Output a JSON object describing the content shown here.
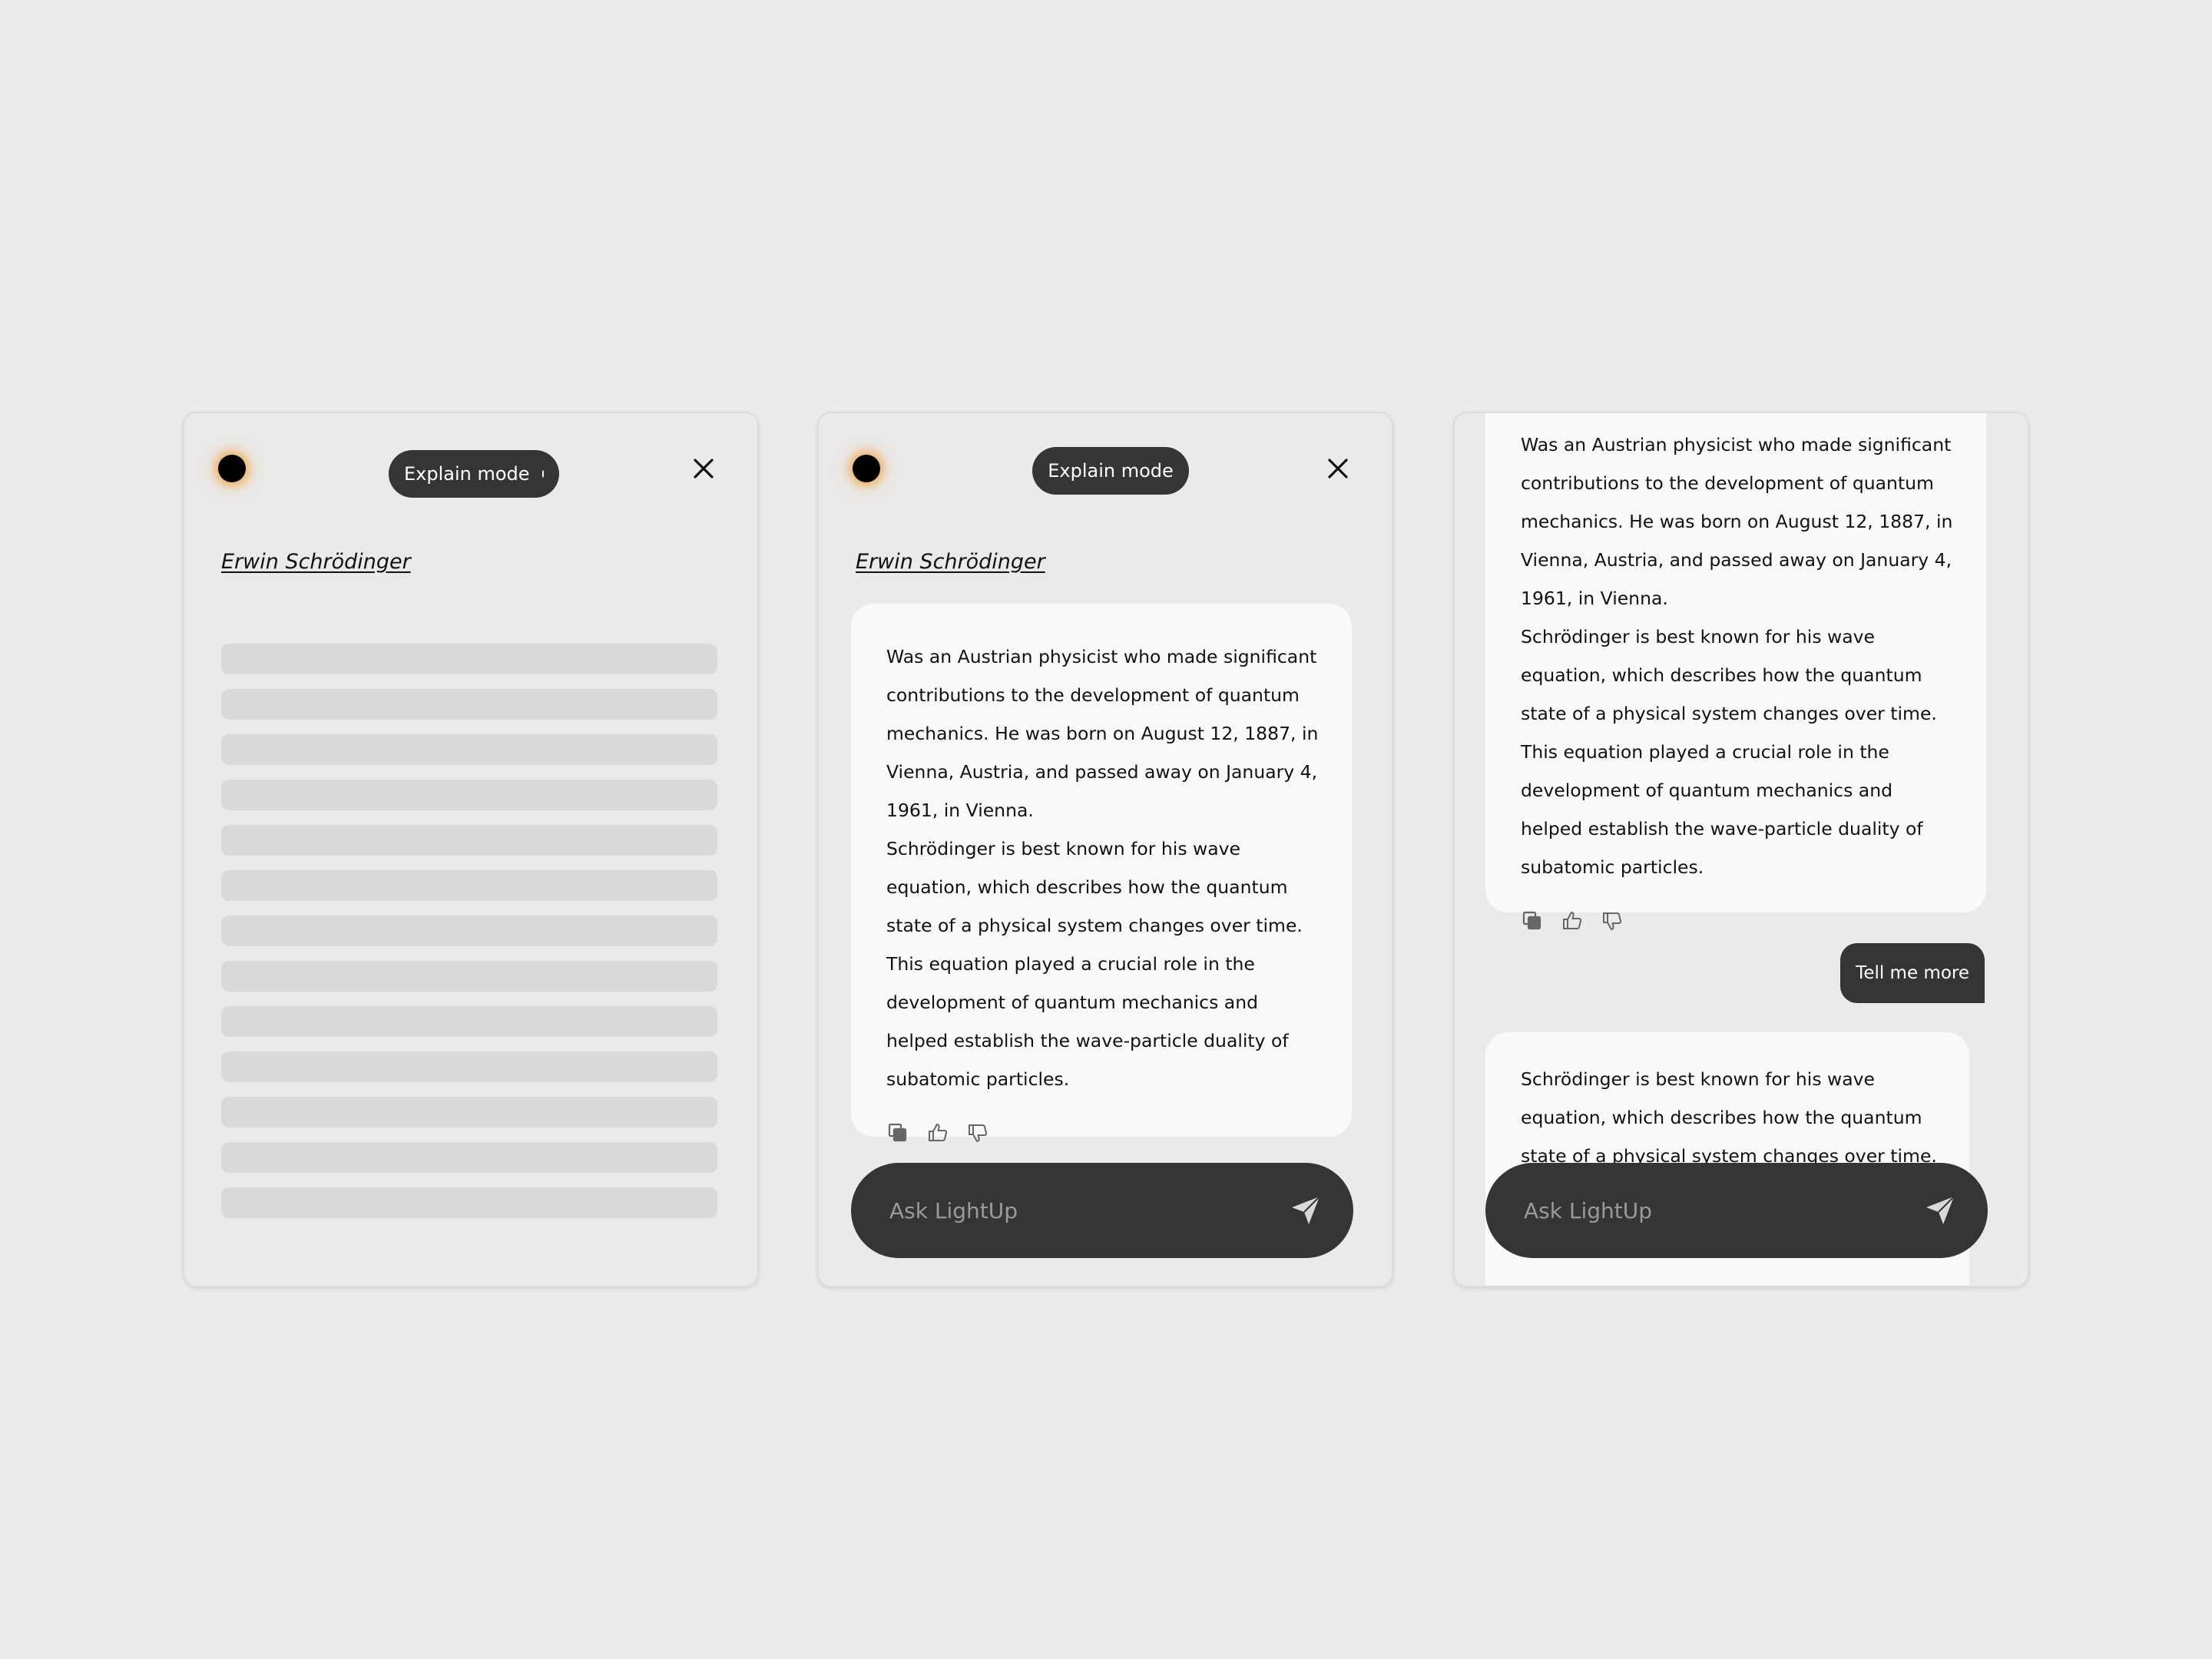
{
  "panel_loading": {
    "mode_label": "Explain mode",
    "subject": "Erwin Schrödinger",
    "skeleton_rows": 13
  },
  "panel_answer": {
    "mode_label": "Explain mode",
    "subject": "Erwin Schrödinger",
    "answer": {
      "p1": "Was an Austrian physicist who made significant contributions to the development of quantum mechanics. He was born on August 12, 1887, in Vienna, Austria, and passed away on January 4, 1961, in Vienna.",
      "p2": "Schrödinger is best known for his wave equation, which describes how the quantum state of a physical system changes over time. This equation played a crucial role in the development of quantum mechanics and helped establish the wave-particle duality of subatomic particles."
    },
    "ask_placeholder": "Ask LightUp"
  },
  "panel_followup": {
    "first_answer": {
      "p1": "Was an Austrian physicist who made significant contributions to the development of quantum mechanics. He was born on August 12, 1887, in Vienna, Austria, and passed away on January 4, 1961, in Vienna.",
      "p2": "Schrödinger is best known for his wave equation, which describes how the quantum state of a physical system changes over time. This equation played a crucial role in the development of quantum mechanics and helped establish the wave-particle duality of subatomic particles."
    },
    "user_message": "Tell me more",
    "second_answer": {
      "p1": "Schrödinger is best known for his wave equation, which describes how the quantum state of a physical system changes over time. This"
    },
    "ask_placeholder": "Ask LightUp"
  },
  "icons": {
    "orb": "glow-orb-icon",
    "close": "close-icon",
    "copy": "copy-icon",
    "like": "thumbs-up-icon",
    "dislike": "thumbs-down-icon",
    "send": "send-icon"
  },
  "colors": {
    "background": "#ebebeb",
    "panel": "#eaeaea",
    "card": "#f9f9f9",
    "dark": "#353535",
    "skeleton": "#d9d9d9",
    "orb_glow": "#f0962a"
  }
}
